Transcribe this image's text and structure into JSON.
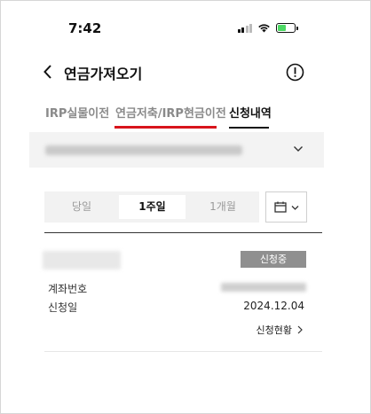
{
  "status_bar": {
    "time": "7:42",
    "icons": [
      "signal-icon",
      "wifi-icon",
      "battery-charging-icon"
    ]
  },
  "header": {
    "title": "연금가져오기",
    "back_icon": "chevron-left-icon",
    "info_icon": "info-circle-icon"
  },
  "tabs": [
    {
      "label": "IRP실물이전",
      "active": false
    },
    {
      "label": "연금저축/IRP현금이전",
      "active": false,
      "highlighted": true
    },
    {
      "label": "신청내역",
      "active": true
    }
  ],
  "account_selector": {
    "icon": "chevron-down-icon"
  },
  "period_selector": {
    "options": [
      "당일",
      "1주일",
      "1개월"
    ],
    "selected": "1주일",
    "calendar_icon": "calendar-icon"
  },
  "request_item": {
    "status_badge": "신청중",
    "account_label": "계좌번호",
    "date_label": "신청일",
    "date_value": "2024.12.04",
    "detail_link": "신청현황"
  },
  "colors": {
    "accent_red": "#d8141c",
    "badge_gray": "#8f8f8f",
    "selector_bg": "#f3f3f3"
  }
}
